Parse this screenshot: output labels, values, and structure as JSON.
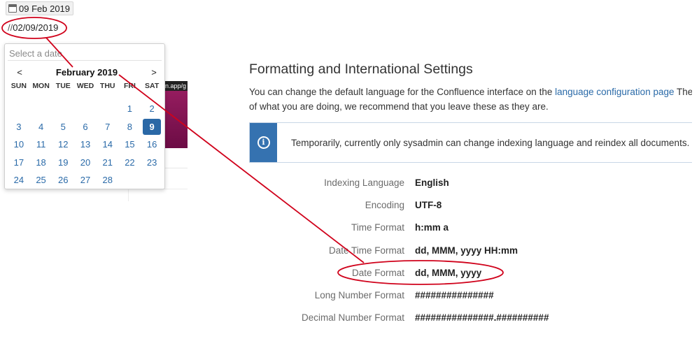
{
  "date_chip": {
    "text": "09 Feb 2019"
  },
  "date_text": {
    "prefix": "//",
    "value": "02/09/2019"
  },
  "datepicker": {
    "placeholder": "Select a date",
    "prev": "<",
    "next": ">",
    "month": "February 2019",
    "weekdays": [
      "SUN",
      "MON",
      "TUE",
      "WED",
      "THU",
      "FRI",
      "SAT"
    ],
    "leading_blanks": 5,
    "days": [
      "1",
      "2",
      "3",
      "4",
      "5",
      "6",
      "7",
      "8",
      "9",
      "10",
      "11",
      "12",
      "13",
      "14",
      "15",
      "16",
      "17",
      "18",
      "19",
      "20",
      "21",
      "22",
      "23",
      "24",
      "25",
      "26",
      "27",
      "28"
    ],
    "selected": "9"
  },
  "background_fragment": {
    "url_text": "n.app/g"
  },
  "settings": {
    "title": "Formatting and International Settings",
    "intro_1": "You can change the default language for the Confluence interface on the ",
    "intro_link": "language configuration page",
    "intro_2": " These",
    "intro_line2": "of what you are doing, we recommend that you leave these as they are.",
    "info_message": "Temporarily, currently only sysadmin can change indexing language and reindex all documents. Co",
    "rows": [
      {
        "label": "Indexing Language",
        "value": "English"
      },
      {
        "label": "Encoding",
        "value": "UTF-8"
      },
      {
        "label": "Time Format",
        "value": "h:mm a"
      },
      {
        "label": "Date Time Format",
        "value": "dd, MMM, yyyy HH:mm"
      },
      {
        "label": "Date Format",
        "value": "dd, MMM, yyyy"
      },
      {
        "label": "Long Number Format",
        "value": "###############"
      },
      {
        "label": "Decimal Number Format",
        "value": "###############.##########"
      }
    ]
  },
  "colors": {
    "accent": "#3572b0",
    "link": "#2a6aa8",
    "annotation": "#d0021b",
    "selected_day": "#2a68a6"
  },
  "icons": {
    "calendar": "calendar-icon",
    "info": "info-icon"
  }
}
